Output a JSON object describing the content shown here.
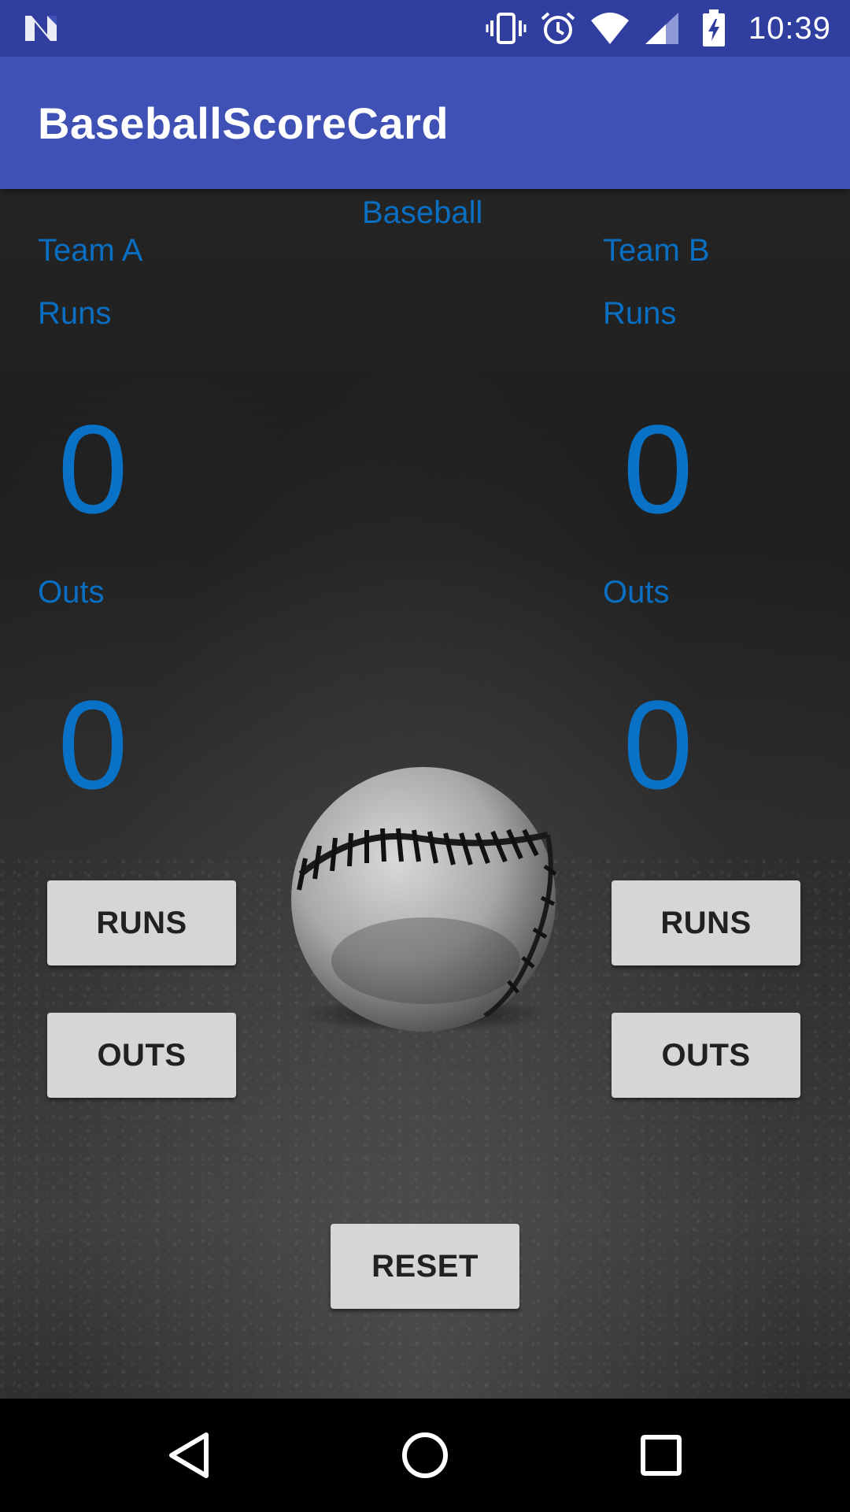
{
  "status_bar": {
    "time": "10:39",
    "icons": [
      "notification-n-icon",
      "vibrate-icon",
      "alarm-icon",
      "wifi-icon",
      "cellular-signal-icon",
      "battery-charging-icon"
    ]
  },
  "app_bar": {
    "title": "BaseballScoreCard",
    "color": "#3F51B5",
    "status_color": "#303F9F"
  },
  "main": {
    "heading": "Baseball",
    "team_a": {
      "name": "Team A",
      "runs_label": "Runs",
      "runs_value": "0",
      "outs_label": "Outs",
      "outs_value": "0",
      "runs_button": "RUNS",
      "outs_button": "OUTS"
    },
    "team_b": {
      "name": "Team B",
      "runs_label": "Runs",
      "runs_value": "0",
      "outs_label": "Outs",
      "outs_value": "0",
      "runs_button": "RUNS",
      "outs_button": "OUTS"
    },
    "reset_button": "RESET",
    "text_color": "#0A6FC2",
    "background_image": "baseball-on-gravel"
  },
  "nav_bar": {
    "buttons": [
      "back-icon",
      "home-icon",
      "recents-icon"
    ]
  }
}
